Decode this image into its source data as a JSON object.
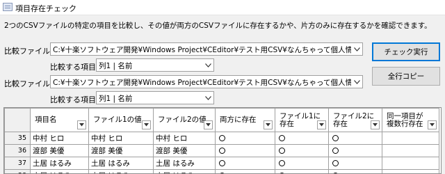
{
  "window": {
    "title": "項目存在チェック"
  },
  "description": "2つのCSVファイルの特定の項目を比較し、その値が両方のCSVファイルに存在するかや、片方のみに存在するかを確認できます。",
  "file1": {
    "label": "比較ファイル1",
    "path": "C:¥十楽ソフトウェア開発¥Windows Project¥CEditor¥テスト用CSV¥なんちゃって個人情報.csv",
    "item_label": "比較する項目",
    "item_value": "列1 | 名前"
  },
  "file2": {
    "label": "比較ファイル2",
    "path": "C:¥十楽ソフトウェア開発¥Windows Project¥CEditor¥テスト用CSV¥なんちゃって個人情報 - コピー.csv",
    "item_label": "比較する項目",
    "item_value": "列1 | 名前"
  },
  "buttons": {
    "check": "チェック実行",
    "copy_all": "全行コピー"
  },
  "grid": {
    "columns": [
      [
        "項目名"
      ],
      [
        "ファイル1の値"
      ],
      [
        "ファイル2の値"
      ],
      [
        "両方に存在"
      ],
      [
        "ファイル1に",
        "存在"
      ],
      [
        "ファイル2に",
        "存在"
      ],
      [
        "同一項目が",
        "複数行存在"
      ]
    ],
    "rows": [
      {
        "num": "35",
        "name": "中村 ヒロ",
        "v1": "中村 ヒロ",
        "v2": "中村 ヒロ"
      },
      {
        "num": "36",
        "name": "渡部 美優",
        "v1": "渡部 美優",
        "v2": "渡部 美優"
      },
      {
        "num": "37",
        "name": "土居 はるみ",
        "v1": "土居 はるみ",
        "v2": "土居 はるみ"
      },
      {
        "num": "38",
        "name": "土居 はるみ",
        "v1": "土居 はるみ",
        "v2": "土居 はるみ"
      }
    ],
    "circle_columns": [
      "both",
      "only1",
      "only2"
    ]
  }
}
